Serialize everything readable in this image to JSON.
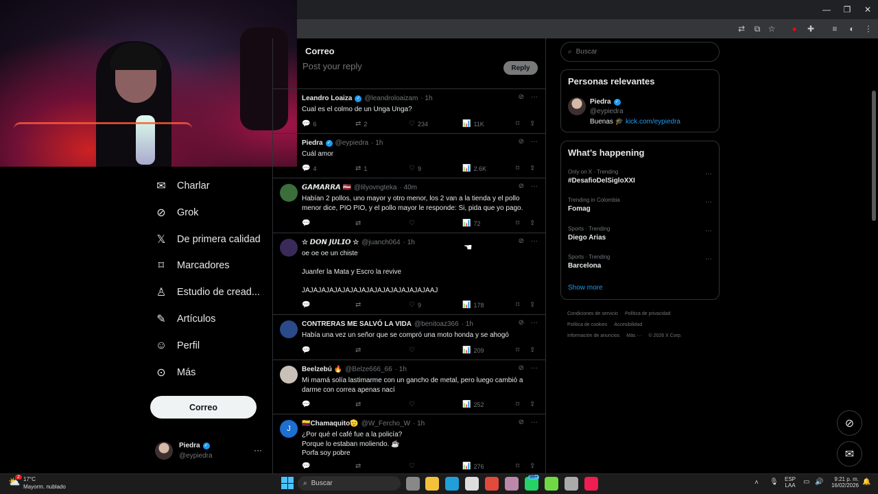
{
  "main": {
    "header_title": "Correo",
    "reply_placeholder": "Post your reply",
    "reply_button": "Reply",
    "tweets": [
      {
        "name": "Leandro Loaiza",
        "verified": true,
        "handle": "@leandroloaizam",
        "time": "· 1h",
        "text": "Cual es el colmo de un Unga Unga?",
        "replies": "6",
        "reposts": "2",
        "likes": "234",
        "views": "11K",
        "avatar_color": "#556"
      },
      {
        "name": "Piedra",
        "verified": true,
        "handle": "@eypiedra",
        "time": "· 1h",
        "text": "Cuál amor",
        "replies": "4",
        "reposts": "1",
        "likes": "9",
        "views": "2.6K",
        "avatar_color": "#000"
      },
      {
        "name": "𝙂𝘼𝙈𝘼𝙍𝙍𝘼 🇱🇻",
        "verified": false,
        "handle": "@lilyovngteka",
        "time": "· 40m",
        "text": "Habían 2 pollos, uno mayor y otro menor, los 2 van a la tienda y el pollo menor dice, PIO PIO, y el pollo mayor le responde: Si, pida que yo pago.",
        "replies": "",
        "reposts": "",
        "likes": "",
        "views": "72",
        "avatar_color": "#3b6e3a"
      },
      {
        "name": "☆ 𝘿𝙊𝙉 𝙅𝙐𝙇𝙄𝙊 ☆",
        "verified": false,
        "handle": "@juanch064",
        "time": "· 1h",
        "text": "oe oe oe un chiste\n\nJuanfer la Mata y Escro la revive\n\nJAJAJAJAJAJAJAJAJAJAJAJAJAJAJAJAAJ",
        "replies": "",
        "reposts": "",
        "likes": "9",
        "views": "178",
        "avatar_color": "#3a2a5a"
      },
      {
        "name": "CONTRERAS ME SALVÓ LA VIDA",
        "verified": false,
        "handle": "@benitoaz366",
        "time": "· 1h",
        "text": "Había una vez un señor que se compró una moto honda y se ahogó",
        "replies": "",
        "reposts": "",
        "likes": "",
        "views": "209",
        "avatar_color": "#2b4a8a"
      },
      {
        "name": "Beelzebú 🔥",
        "verified": false,
        "handle": "@Belze666_66",
        "time": "· 1h",
        "text": "Mi mamá solía lastimarme con un gancho de metal, pero luego cambió a darme con correa apenas nací",
        "replies": "",
        "reposts": "",
        "likes": "",
        "views": "252",
        "avatar_color": "#c9c0b8"
      },
      {
        "name": "🇨🇴Chamaquito🫡",
        "verified": false,
        "handle": "@W_Fercho_W",
        "time": "· 1h",
        "text": "¿Por qué el café fue a la policía?\nPorque lo estaban moliendo. ☕\nPorfa soy pobre",
        "replies": "",
        "reposts": "",
        "likes": "",
        "views": "276",
        "avatar_color": "#1d6fd0",
        "avatar_letter": "J"
      }
    ]
  },
  "nav": {
    "items": [
      {
        "label": "Charlar",
        "icon": "mail-icon"
      },
      {
        "label": "Grok",
        "icon": "grok-icon"
      },
      {
        "label": "De primera calidad",
        "icon": "x-logo-icon"
      },
      {
        "label": "Marcadores",
        "icon": "bookmark-icon"
      },
      {
        "label": "Estudio de cread...",
        "icon": "creator-studio-icon"
      },
      {
        "label": "Artículos",
        "icon": "article-icon"
      },
      {
        "label": "Perfil",
        "icon": "person-icon"
      },
      {
        "label": "Más",
        "icon": "more-circle-icon"
      }
    ],
    "post_button": "Correo",
    "account_name": "Piedra",
    "account_handle": "@eypiedra"
  },
  "right": {
    "search_placeholder": "Buscar",
    "relevant_title": "Personas relevantes",
    "relevant_name": "Piedra",
    "relevant_handle": "@eypiedra",
    "relevant_bio": "Buenas",
    "relevant_link": "kick.com/eypiedra",
    "happening_title": "What’s happening",
    "trends": [
      {
        "meta": "Only on X · Trending",
        "name": "#DesafioDelSigloXXI"
      },
      {
        "meta": "Trending in Colombia",
        "name": "Fomag"
      },
      {
        "meta": "Sports · Trending",
        "name": "Diego Arias"
      },
      {
        "meta": "Sports · Trending",
        "name": "Barcelona"
      }
    ],
    "show_more": "Show more",
    "footer": [
      "Condiciones de servicio",
      "Política de privacidad",
      "Política de cookies",
      "Accesibilidad",
      "Información de anuncios",
      "Más ···",
      "© 2026 X Corp."
    ]
  },
  "taskbar": {
    "weather_temp": "17°C",
    "weather_desc": "Mayorm. nublado",
    "search": "Buscar",
    "lang1": "ESP",
    "lang2": "LAA",
    "time": "9:21 p. m.",
    "date": "16/02/2026",
    "badge_weather": "2",
    "badge_whatsapp": "99+"
  },
  "colors": {
    "accent": "#1d9bf0",
    "background": "#000000",
    "border": "#2f3336",
    "muted": "#71767b"
  }
}
